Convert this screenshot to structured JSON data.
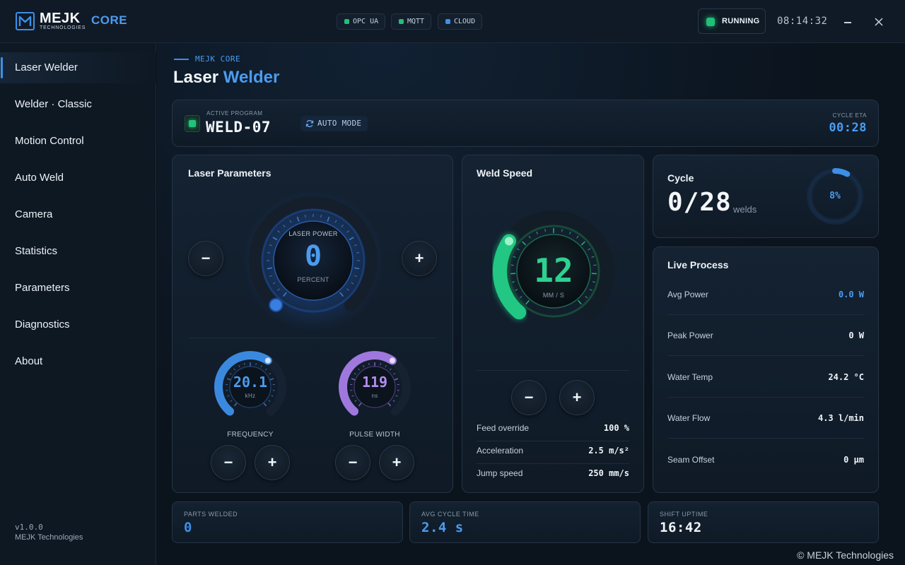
{
  "app": {
    "brand": "MEJK",
    "brand_sub": "TECHNOLOGIES",
    "core": "CORE",
    "protocols": [
      {
        "label": "OPC UA",
        "color": "#20c07a"
      },
      {
        "label": "MQTT",
        "color": "#20c07a"
      },
      {
        "label": "CLOUD",
        "color": "#3d8fe8"
      }
    ],
    "status": "RUNNING",
    "clock": "08:14:32"
  },
  "sidebar": {
    "items": [
      {
        "label": "Laser Welder",
        "active": true
      },
      {
        "label": "Welder · Classic"
      },
      {
        "label": "Motion Control"
      },
      {
        "label": "Auto Weld"
      },
      {
        "label": "Camera"
      },
      {
        "label": "Statistics"
      },
      {
        "label": "Parameters"
      },
      {
        "label": "Diagnostics"
      },
      {
        "label": "About"
      }
    ],
    "version": "v1.0.0",
    "company": "MEJK Technologies"
  },
  "header": {
    "crumb": "MEJK CORE",
    "title_main": "Laser",
    "title_accent": "Welder"
  },
  "program": {
    "label": "ACTIVE PROGRAM",
    "name": "WELD-07",
    "mode": "AUTO MODE",
    "eta_label": "CYCLE ETA",
    "eta": "00:28"
  },
  "laser": {
    "title": "Laser Parameters",
    "power_label": "LASER POWER",
    "power_value": "0",
    "power_unit": "PERCENT",
    "minus": "−",
    "plus": "+",
    "frequency": {
      "value": "20.1",
      "unit": "kHz",
      "label": "FREQUENCY",
      "level": 0.62
    },
    "pulse": {
      "value": "119",
      "unit": "ns",
      "label": "PULSE WIDTH",
      "level": 0.62
    }
  },
  "speed": {
    "title": "Weld Speed",
    "value": "12",
    "unit": "MM / S",
    "level": 0.3,
    "minus": "−",
    "plus": "+",
    "rows": [
      {
        "k": "Feed override",
        "v": "100 %"
      },
      {
        "k": "Acceleration",
        "v": "2.5 m/s²"
      },
      {
        "k": "Jump speed",
        "v": "250 mm/s"
      }
    ]
  },
  "cycle": {
    "title": "Cycle",
    "count": "0/28",
    "unit": "welds",
    "pct": "8%",
    "level": 0.08
  },
  "live": {
    "title": "Live Process",
    "rows": [
      {
        "k": "Avg Power",
        "v": "0.0 W",
        "accent": true
      },
      {
        "k": "Peak Power",
        "v": "0 W"
      },
      {
        "k": "Water Temp",
        "v": "24.2 °C"
      },
      {
        "k": "Water Flow",
        "v": "4.3 l/min"
      },
      {
        "k": "Seam Offset",
        "v": "0 µm"
      }
    ]
  },
  "kpis": [
    {
      "k": "PARTS WELDED",
      "v": "0",
      "color": "#3d8fe8"
    },
    {
      "k": "AVG CYCLE TIME",
      "v": "2.4 s",
      "color": "#4b9cf0"
    },
    {
      "k": "SHIFT UPTIME",
      "v": "16:42",
      "color": "#f1f5f9"
    }
  ],
  "footer": {
    "copyright": "© MEJK Technologies"
  },
  "colors": {
    "accent": "#3d8fe8",
    "success": "#20c07a",
    "purple": "#a77de8"
  }
}
